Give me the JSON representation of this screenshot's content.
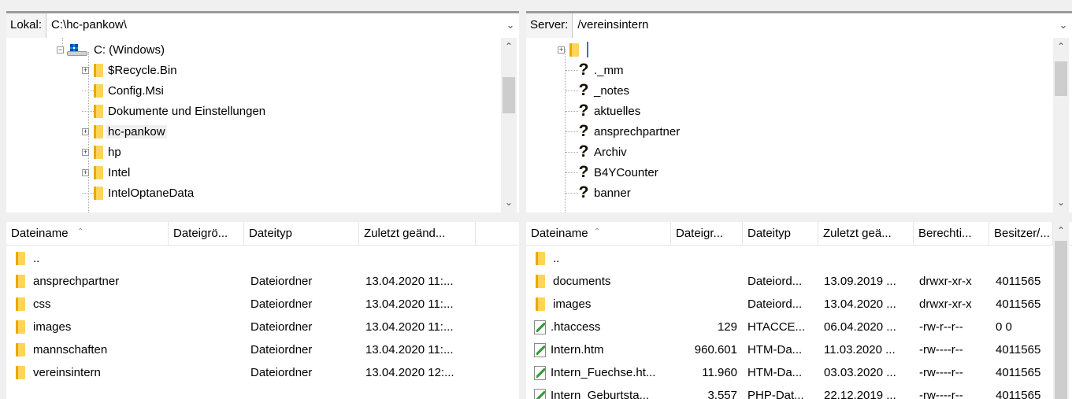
{
  "local": {
    "path_label": "Lokal:",
    "path_value": "C:\\hc-pankow\\",
    "tree": {
      "drive": "C: (Windows)",
      "items": [
        {
          "label": "$Recycle.Bin",
          "expandable": true
        },
        {
          "label": "Config.Msi",
          "expandable": false
        },
        {
          "label": "Dokumente und Einstellungen",
          "expandable": false
        },
        {
          "label": "hc-pankow",
          "expandable": true,
          "selected": true
        },
        {
          "label": "hp",
          "expandable": true
        },
        {
          "label": "Intel",
          "expandable": true
        },
        {
          "label": "IntelOptaneData",
          "expandable": false
        }
      ]
    },
    "list": {
      "columns": [
        "Dateiname",
        "Dateigrö...",
        "Dateityp",
        "Zuletzt geänd..."
      ],
      "rows": [
        {
          "name": "..",
          "size": "",
          "type": "",
          "modified": ""
        },
        {
          "name": "ansprechpartner",
          "size": "",
          "type": "Dateiordner",
          "modified": "13.04.2020 11:..."
        },
        {
          "name": "css",
          "size": "",
          "type": "Dateiordner",
          "modified": "13.04.2020 11:..."
        },
        {
          "name": "images",
          "size": "",
          "type": "Dateiordner",
          "modified": "13.04.2020 11:..."
        },
        {
          "name": "mannschaften",
          "size": "",
          "type": "Dateiordner",
          "modified": "13.04.2020 11:..."
        },
        {
          "name": "vereinsintern",
          "size": "",
          "type": "Dateiordner",
          "modified": "13.04.2020 12:..."
        }
      ]
    }
  },
  "remote": {
    "path_label": "Server:",
    "path_value": "/vereinsintern",
    "tree": {
      "items": [
        {
          "label": "._mm"
        },
        {
          "label": "_notes"
        },
        {
          "label": "aktuelles"
        },
        {
          "label": "ansprechpartner"
        },
        {
          "label": "Archiv"
        },
        {
          "label": "B4YCounter"
        },
        {
          "label": "banner"
        }
      ]
    },
    "list": {
      "columns": [
        "Dateiname",
        "Dateigr...",
        "Dateityp",
        "Zuletzt geä...",
        "Berechti...",
        "Besitzer/..."
      ],
      "rows": [
        {
          "name": "..",
          "icon": "folder",
          "size": "",
          "type": "",
          "modified": "",
          "perms": "",
          "owner": ""
        },
        {
          "name": "documents",
          "icon": "folder",
          "size": "",
          "type": "Dateiord...",
          "modified": "13.09.2019 ...",
          "perms": "drwxr-xr-x",
          "owner": "4011565"
        },
        {
          "name": "images",
          "icon": "folder",
          "size": "",
          "type": "Dateiord...",
          "modified": "13.04.2020 ...",
          "perms": "drwxr-xr-x",
          "owner": "4011565"
        },
        {
          "name": ".htaccess",
          "icon": "file",
          "size": "129",
          "type": "HTACCE...",
          "modified": "06.04.2020 ...",
          "perms": "-rw-r--r--",
          "owner": "0 0"
        },
        {
          "name": "Intern.htm",
          "icon": "file",
          "size": "960.601",
          "type": "HTM-Da...",
          "modified": "11.03.2020 ...",
          "perms": "-rw----r--",
          "owner": "4011565"
        },
        {
          "name": "Intern_Fuechse.ht...",
          "icon": "file",
          "size": "11.960",
          "type": "HTM-Da...",
          "modified": "03.03.2020 ...",
          "perms": "-rw----r--",
          "owner": "4011565"
        },
        {
          "name": "Intern_Geburtsta...",
          "icon": "file",
          "size": "3.557",
          "type": "PHP-Dat...",
          "modified": "22.12.2019 ...",
          "perms": "-rw----r--",
          "owner": "4011565"
        }
      ]
    }
  }
}
